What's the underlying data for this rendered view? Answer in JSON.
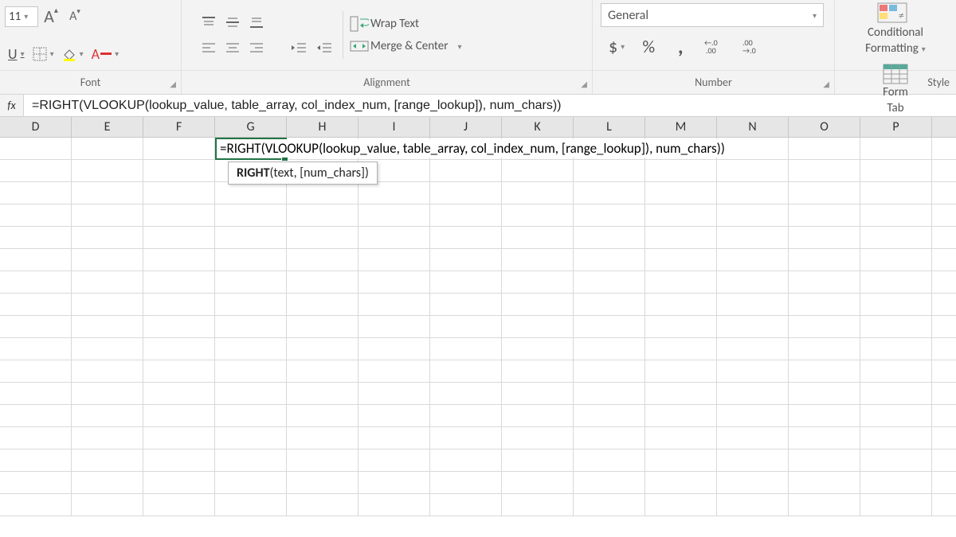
{
  "ribbon": {
    "font": {
      "size": "11",
      "groupLabel": "Font"
    },
    "alignment": {
      "wrapText": "Wrap Text",
      "mergeCenter": "Merge & Center",
      "groupLabel": "Alignment"
    },
    "number": {
      "format": "General",
      "groupLabel": "Number"
    },
    "styles": {
      "conditional1": "Conditional",
      "conditional2": "Formatting",
      "formatAs1": "Form",
      "formatAs2": "Tab",
      "groupLabel": "Style"
    }
  },
  "formulaBar": {
    "label": "fx",
    "value": "=RIGHT(VLOOKUP(lookup_value, table_array, col_index_num, [range_lookup]), num_chars))"
  },
  "columns": [
    "D",
    "E",
    "F",
    "G",
    "H",
    "I",
    "J",
    "K",
    "L",
    "M",
    "N",
    "O",
    "P"
  ],
  "activeCell": {
    "content": "=RIGHT(VLOOKUP(lookup_value, table_array, col_index_num, [range_lookup]), num_chars))"
  },
  "tooltip": {
    "bold": "RIGHT",
    "rest": "(text, [num_chars])"
  }
}
